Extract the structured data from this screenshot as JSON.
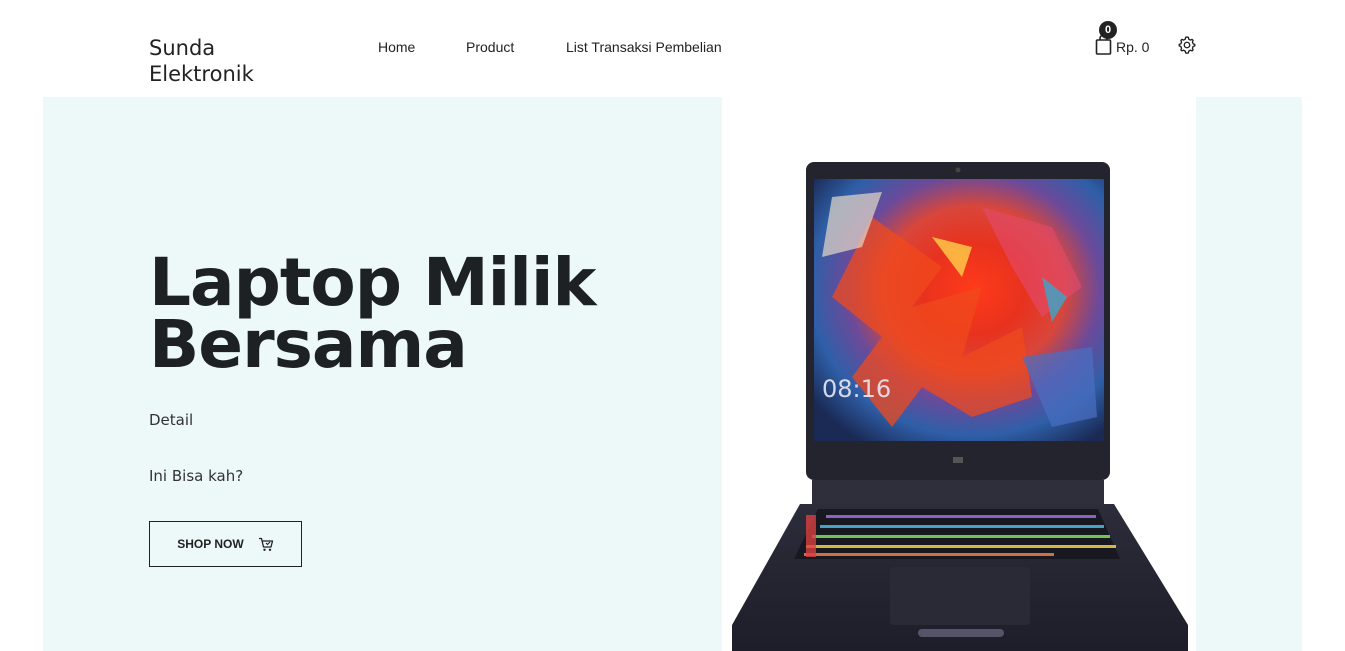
{
  "brand": {
    "line1": "Sunda",
    "line2": "Elektronik"
  },
  "nav": [
    {
      "label": "Home"
    },
    {
      "label": "Product"
    },
    {
      "label": "List Transaksi Pembelian"
    }
  ],
  "cart": {
    "count": "0",
    "amount": "Rp. 0",
    "icon": "shopping-bag-icon"
  },
  "settings": {
    "icon": "gear-icon"
  },
  "hero": {
    "title_line1": "Laptop Milik",
    "title_line2": "Bersama",
    "detail": "Detail",
    "description": "Ini Bisa kah?",
    "button_label": "SHOP NOW",
    "button_icon": "cart-icon",
    "image": "laptop-image",
    "screen_time": "08:16",
    "background_color": "#edf9f9"
  }
}
